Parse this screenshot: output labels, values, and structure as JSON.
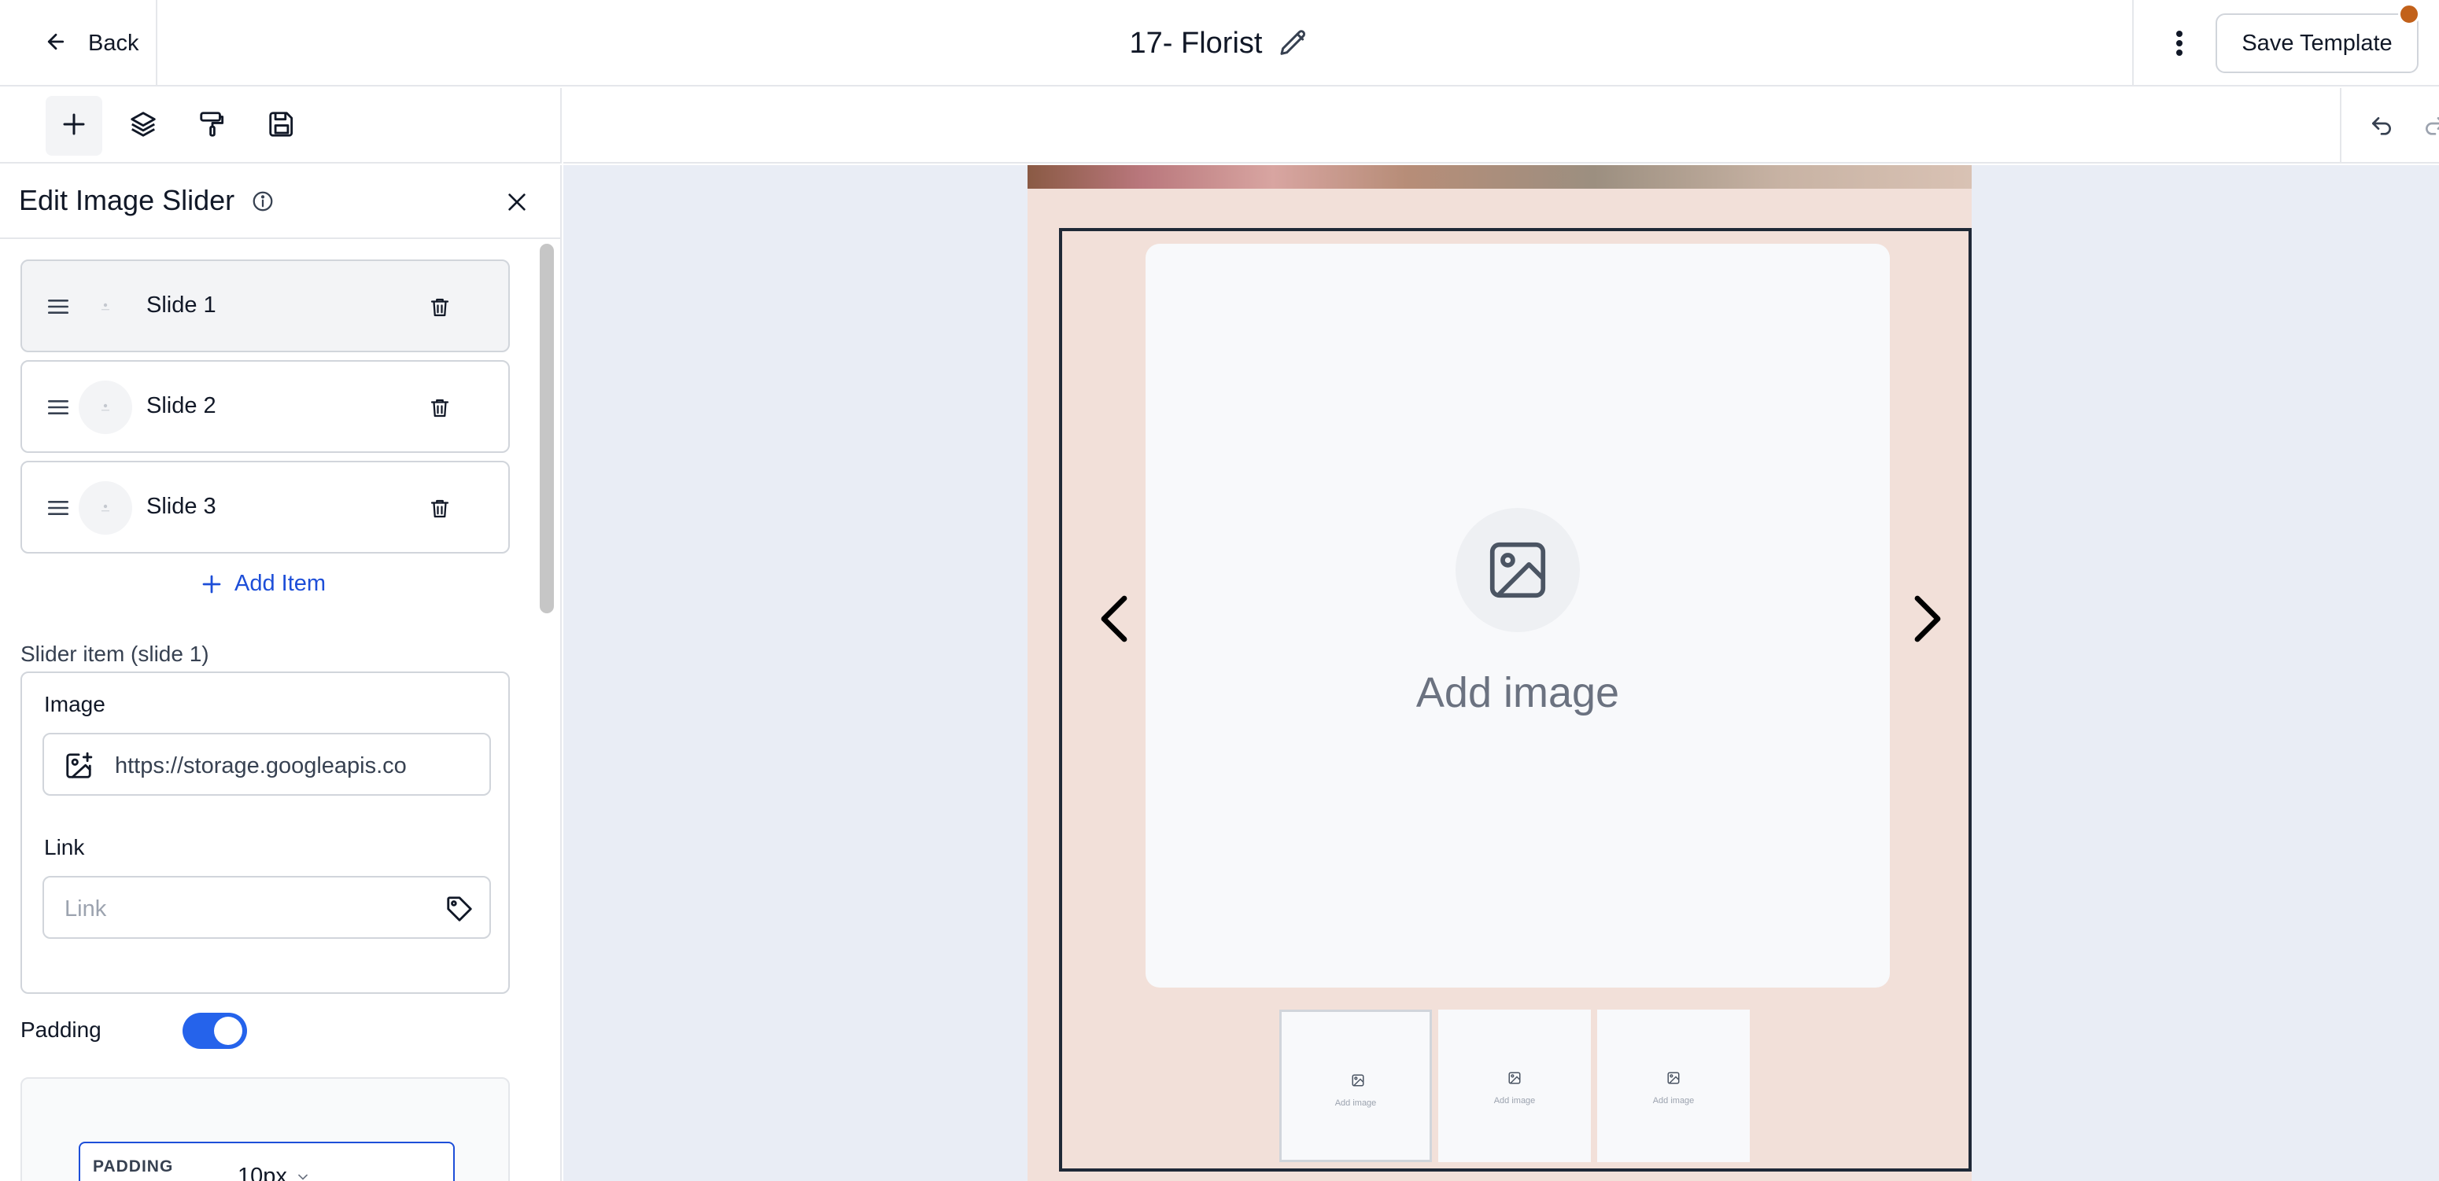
{
  "header": {
    "back_label": "Back",
    "title": "17- Florist",
    "save_label": "Save Template",
    "notification_color": "#c2611a"
  },
  "toolbar": {
    "tools": [
      "plus-icon",
      "layers-icon",
      "paint-roller-icon",
      "save-icon"
    ],
    "canvas_tools": [
      "undo-icon",
      "redo-icon"
    ]
  },
  "panel": {
    "title": "Edit Image Slider",
    "slides": [
      {
        "label": "Slide 1",
        "selected": true
      },
      {
        "label": "Slide 2",
        "selected": false
      },
      {
        "label": "Slide 3",
        "selected": false
      }
    ],
    "add_item_label": "Add Item",
    "slider_item_label": "Slider item (slide 1)",
    "image_label": "Image",
    "image_value": "https://storage.googleapis.co",
    "link_label": "Link",
    "link_placeholder": "Link",
    "padding_label": "Padding",
    "padding_enabled": true,
    "padding_box_label": "PADDING",
    "padding_value": "10px",
    "accent_color": "#2563eb"
  },
  "canvas": {
    "main_image_text": "Add image",
    "thumbnails": [
      {
        "label": "Add image",
        "active": true
      },
      {
        "label": "Add image",
        "active": false
      },
      {
        "label": "Add image",
        "active": false
      }
    ],
    "email_bg_color": "#f2e0d9",
    "canvas_bg_color": "#e9edf5"
  }
}
